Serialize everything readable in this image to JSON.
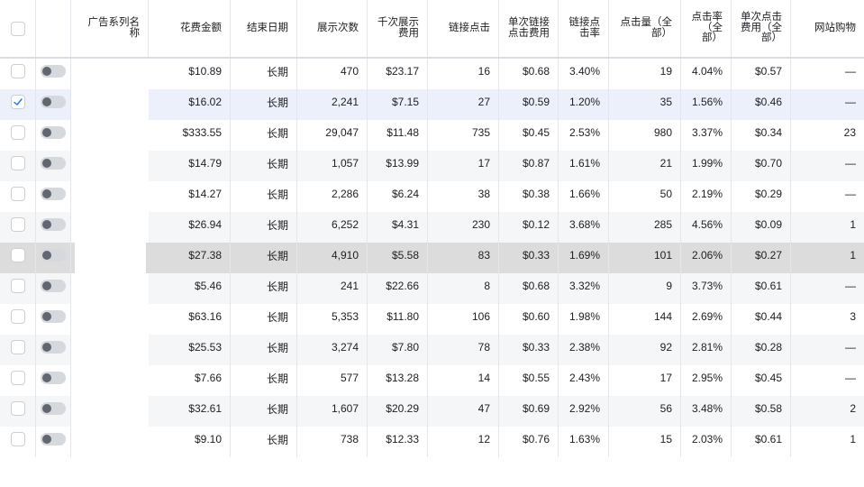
{
  "columns": {
    "campaign_name": "广告系列名称",
    "spend": "花费金额",
    "end_date": "结束日期",
    "impressions": "展示次数",
    "cpm_1": "千次展示",
    "cpm_2": "费用",
    "link_clicks": "链接点击",
    "cpc_link_1": "单次链接",
    "cpc_link_2": "点击费用",
    "ctr_link_1": "链接点",
    "ctr_link_2": "击率",
    "clicks_all_1": "点击量（全",
    "clicks_all_2": "部）",
    "ctr_all_1": "点击率",
    "ctr_all_2": "（全",
    "ctr_all_3": "部）",
    "cpc_all_1": "单次点击",
    "cpc_all_2": "费用（全",
    "cpc_all_3": "部）",
    "purchases": "网站购物"
  },
  "rows": [
    {
      "checked": false,
      "spend": "$10.89",
      "end_date": "长期",
      "impressions": "470",
      "cpm": "$23.17",
      "link_clicks": "16",
      "cpc_link": "$0.68",
      "ctr_link": "3.40%",
      "clicks_all": "19",
      "ctr_all": "4.04%",
      "cpc_all": "$0.57",
      "purchases": "—"
    },
    {
      "checked": true,
      "spend": "$16.02",
      "end_date": "长期",
      "impressions": "2,241",
      "cpm": "$7.15",
      "link_clicks": "27",
      "cpc_link": "$0.59",
      "ctr_link": "1.20%",
      "clicks_all": "35",
      "ctr_all": "1.56%",
      "cpc_all": "$0.46",
      "purchases": "—"
    },
    {
      "checked": false,
      "spend": "$333.55",
      "end_date": "长期",
      "impressions": "29,047",
      "cpm": "$11.48",
      "link_clicks": "735",
      "cpc_link": "$0.45",
      "ctr_link": "2.53%",
      "clicks_all": "980",
      "ctr_all": "3.37%",
      "cpc_all": "$0.34",
      "purchases": "23"
    },
    {
      "checked": false,
      "spend": "$14.79",
      "end_date": "长期",
      "impressions": "1,057",
      "cpm": "$13.99",
      "link_clicks": "17",
      "cpc_link": "$0.87",
      "ctr_link": "1.61%",
      "clicks_all": "21",
      "ctr_all": "1.99%",
      "cpc_all": "$0.70",
      "purchases": "—"
    },
    {
      "checked": false,
      "spend": "$14.27",
      "end_date": "长期",
      "impressions": "2,286",
      "cpm": "$6.24",
      "link_clicks": "38",
      "cpc_link": "$0.38",
      "ctr_link": "1.66%",
      "clicks_all": "50",
      "ctr_all": "2.19%",
      "cpc_all": "$0.29",
      "purchases": "—"
    },
    {
      "checked": false,
      "spend": "$26.94",
      "end_date": "长期",
      "impressions": "6,252",
      "cpm": "$4.31",
      "link_clicks": "230",
      "cpc_link": "$0.12",
      "ctr_link": "3.68%",
      "clicks_all": "285",
      "ctr_all": "4.56%",
      "cpc_all": "$0.09",
      "purchases": "1"
    },
    {
      "checked": false,
      "spend": "$27.38",
      "end_date": "长期",
      "impressions": "4,910",
      "cpm": "$5.58",
      "link_clicks": "83",
      "cpc_link": "$0.33",
      "ctr_link": "1.69%",
      "clicks_all": "101",
      "ctr_all": "2.06%",
      "cpc_all": "$0.27",
      "purchases": "1"
    },
    {
      "checked": false,
      "spend": "$5.46",
      "end_date": "长期",
      "impressions": "241",
      "cpm": "$22.66",
      "link_clicks": "8",
      "cpc_link": "$0.68",
      "ctr_link": "3.32%",
      "clicks_all": "9",
      "ctr_all": "3.73%",
      "cpc_all": "$0.61",
      "purchases": "—"
    },
    {
      "checked": false,
      "spend": "$63.16",
      "end_date": "长期",
      "impressions": "5,353",
      "cpm": "$11.80",
      "link_clicks": "106",
      "cpc_link": "$0.60",
      "ctr_link": "1.98%",
      "clicks_all": "144",
      "ctr_all": "2.69%",
      "cpc_all": "$0.44",
      "purchases": "3"
    },
    {
      "checked": false,
      "spend": "$25.53",
      "end_date": "长期",
      "impressions": "3,274",
      "cpm": "$7.80",
      "link_clicks": "78",
      "cpc_link": "$0.33",
      "ctr_link": "2.38%",
      "clicks_all": "92",
      "ctr_all": "2.81%",
      "cpc_all": "$0.28",
      "purchases": "—"
    },
    {
      "checked": false,
      "spend": "$7.66",
      "end_date": "长期",
      "impressions": "577",
      "cpm": "$13.28",
      "link_clicks": "14",
      "cpc_link": "$0.55",
      "ctr_link": "2.43%",
      "clicks_all": "17",
      "ctr_all": "2.95%",
      "cpc_all": "$0.45",
      "purchases": "—"
    },
    {
      "checked": false,
      "spend": "$32.61",
      "end_date": "长期",
      "impressions": "1,607",
      "cpm": "$20.29",
      "link_clicks": "47",
      "cpc_link": "$0.69",
      "ctr_link": "2.92%",
      "clicks_all": "56",
      "ctr_all": "3.48%",
      "cpc_all": "$0.58",
      "purchases": "2"
    },
    {
      "checked": false,
      "spend": "$9.10",
      "end_date": "长期",
      "impressions": "738",
      "cpm": "$12.33",
      "link_clicks": "12",
      "cpc_link": "$0.76",
      "ctr_link": "1.63%",
      "clicks_all": "15",
      "ctr_all": "2.03%",
      "cpc_all": "$0.61",
      "purchases": "1"
    }
  ]
}
